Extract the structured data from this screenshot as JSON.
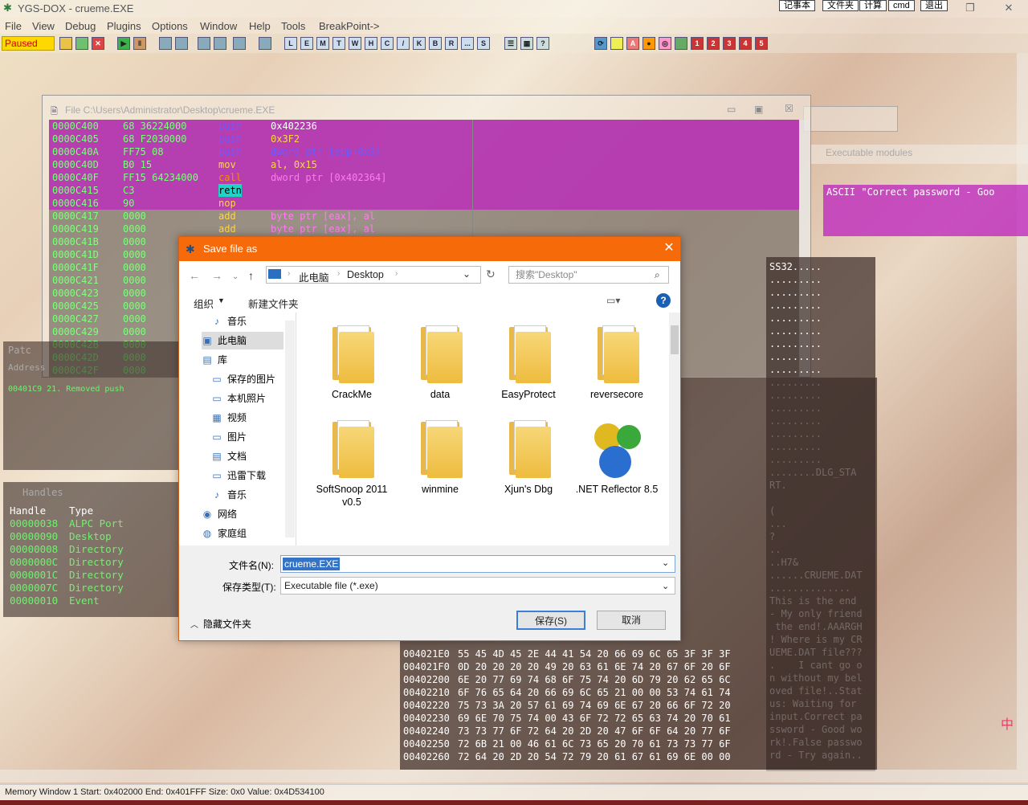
{
  "window": {
    "title": "YGS-DOX - crueme.EXE",
    "top_buttons": [
      "记事本",
      "文件夹",
      "计算",
      "cmd",
      "退出"
    ]
  },
  "menu": [
    "File",
    "View",
    "Debug",
    "Plugins",
    "Options",
    "Window",
    "Help",
    "Tools",
    "BreakPoint->"
  ],
  "toolbar": {
    "status": "Paused",
    "letters": [
      "L",
      "E",
      "M",
      "T",
      "W",
      "H",
      "C",
      "/",
      "K",
      "B",
      "R",
      "...",
      "S"
    ],
    "numbers": [
      "1",
      "2",
      "3",
      "4",
      "5"
    ]
  },
  "cpu": {
    "title": "File C:\\Users\\Administrator\\Desktop\\crueme.EXE",
    "rows": [
      {
        "addr": "0000C400",
        "hex": "68 36224000",
        "mn": "push",
        "op": "0x402236"
      },
      {
        "addr": "0000C405",
        "hex": "68 F2030000",
        "mn": "push",
        "op": "0x3F2"
      },
      {
        "addr": "0000C40A",
        "hex": "FF75 08",
        "mn": "push",
        "op": "dword ptr [ebp+0x8]"
      },
      {
        "addr": "0000C40D",
        "hex": "B0 15",
        "mn": "mov",
        "op": "al, 0x15"
      },
      {
        "addr": "0000C40F",
        "hex": "FF15 64234000",
        "mn": "call",
        "op": "dword ptr [0x402364]"
      },
      {
        "addr": "0000C415",
        "hex": "C3",
        "mn": "retn",
        "op": ""
      },
      {
        "addr": "0000C416",
        "hex": "90",
        "mn": "nop",
        "op": ""
      },
      {
        "addr": "0000C417",
        "hex": "0000",
        "mn": "add",
        "op": "byte ptr [eax], al"
      },
      {
        "addr": "0000C419",
        "hex": "0000",
        "mn": "add",
        "op": "byte ptr [eax], al"
      },
      {
        "addr": "0000C41B",
        "hex": "0000",
        "mn": "",
        "op": ""
      },
      {
        "addr": "0000C41D",
        "hex": "0000",
        "mn": "",
        "op": ""
      },
      {
        "addr": "0000C41F",
        "hex": "0000",
        "mn": "",
        "op": ""
      },
      {
        "addr": "0000C421",
        "hex": "0000",
        "mn": "",
        "op": ""
      },
      {
        "addr": "0000C423",
        "hex": "0000",
        "mn": "",
        "op": ""
      },
      {
        "addr": "0000C425",
        "hex": "0000",
        "mn": "",
        "op": ""
      },
      {
        "addr": "0000C427",
        "hex": "0000",
        "mn": "",
        "op": ""
      },
      {
        "addr": "0000C429",
        "hex": "0000",
        "mn": "",
        "op": ""
      },
      {
        "addr": "0000C42B",
        "hex": "0000",
        "mn": "",
        "op": ""
      },
      {
        "addr": "0000C42D",
        "hex": "0000",
        "mn": "",
        "op": ""
      },
      {
        "addr": "0000C42F",
        "hex": "0000",
        "mn": "",
        "op": ""
      }
    ]
  },
  "ascii_panel": {
    "text": "ASCII \"Correct password - Goo"
  },
  "exec_modules": {
    "title": "Executable modules"
  },
  "patches": {
    "title": "Patc",
    "col": "Address",
    "row1": "00401C9  21. Removed push"
  },
  "handles": {
    "title": "Handles",
    "headers": [
      "Handle",
      "Type"
    ],
    "rows": [
      [
        "00000038",
        "ALPC Port"
      ],
      [
        "00000090",
        "Desktop"
      ],
      [
        "00000008",
        "Directory"
      ],
      [
        "0000000C",
        "Directory"
      ],
      [
        "0000001C",
        "Directory"
      ],
      [
        "0000007C",
        "Directory"
      ],
      [
        "00000010",
        "Event"
      ]
    ]
  },
  "dump": {
    "rows": [
      {
        "addr": "004021E0",
        "hex": "55 45 4D 45 2E 44 41 54 20 66 69 6C 65 3F 3F 3F"
      },
      {
        "addr": "004021F0",
        "hex": "0D 20 20 20 20 49 20 63 61 6E 74 20 67 6F 20 6F"
      },
      {
        "addr": "00402200",
        "hex": "6E 20 77 69 74 68 6F 75 74 20 6D 79 20 62 65 6C"
      },
      {
        "addr": "00402210",
        "hex": "6F 76 65 64 20 66 69 6C 65 21 00 00 53 74 61 74"
      },
      {
        "addr": "00402220",
        "hex": "75 73 3A 20 57 61 69 74 69 6E 67 20 66 6F 72 20"
      },
      {
        "addr": "00402230",
        "hex": "69 6E 70 75 74 00 43 6F 72 72 65 63 74 20 70 61"
      },
      {
        "addr": "00402240",
        "hex": "73 73 77 6F 72 64 20 2D 20 47 6F 6F 64 20 77 6F"
      },
      {
        "addr": "00402250",
        "hex": "72 6B 21 00 46 61 6C 73 65 20 70 61 73 73 77 6F"
      },
      {
        "addr": "00402260",
        "hex": "72 64 20 2D 20 54 72 79 20 61 67 61 69 6E 00 00"
      }
    ],
    "ascii": [
      "SS32.....",
      ".........",
      ".........",
      ".........",
      ".........",
      ".........",
      ".........",
      ".........",
      ".........",
      ".........",
      ".........",
      ".........",
      ".........",
      ".........",
      ".........",
      ".........",
      "........DLG_STA",
      "RT.",
      "",
      "(",
      "...",
      "?",
      "..",
      "..H7&",
      "......CRUEME.DAT",
      "..............",
      "This is the end",
      "- My only friend",
      " the end!.AAARGH",
      "! Where is my CR",
      "UEME.DAT file???",
      ".    I cant go o",
      "n without my bel",
      "oved file!..Stat",
      "us: Waiting for ",
      "input.Correct pa",
      "ssword - Good wo",
      "rk!.False passwo",
      "rd - Try again.."
    ]
  },
  "dialog": {
    "title": "Save file as",
    "path": [
      "此电脑",
      "Desktop"
    ],
    "search_placeholder": "搜索\"Desktop\"",
    "organize": "组织",
    "new_folder": "新建文件夹",
    "nav": [
      "音乐",
      "此电脑",
      "库",
      "保存的图片",
      "本机照片",
      "视频",
      "图片",
      "文档",
      "迅雷下载",
      "音乐",
      "网络",
      "家庭组"
    ],
    "files": [
      "CrackMe",
      "data",
      "EasyProtect",
      "reversecore",
      "SoftSnoop 2011 v0.5",
      "winmine",
      "Xjun's Dbg",
      ".NET Reflector 8.5"
    ],
    "filename_label": "文件名(N):",
    "filename": "crueme.EXE",
    "filetype_label": "保存类型(T):",
    "filetype": "Executable file (*.exe)",
    "hide_folders": "隐藏文件夹",
    "save": "保存(S)",
    "cancel": "取消"
  },
  "status": "Memory Window 1  Start: 0x402000  End: 0x401FFF  Size: 0x0 Value: 0x4D534100",
  "colors": {
    "accent": "#f66a0a",
    "selection": "#3574c4",
    "purple": "#be28be",
    "green": "#7dff7d"
  }
}
